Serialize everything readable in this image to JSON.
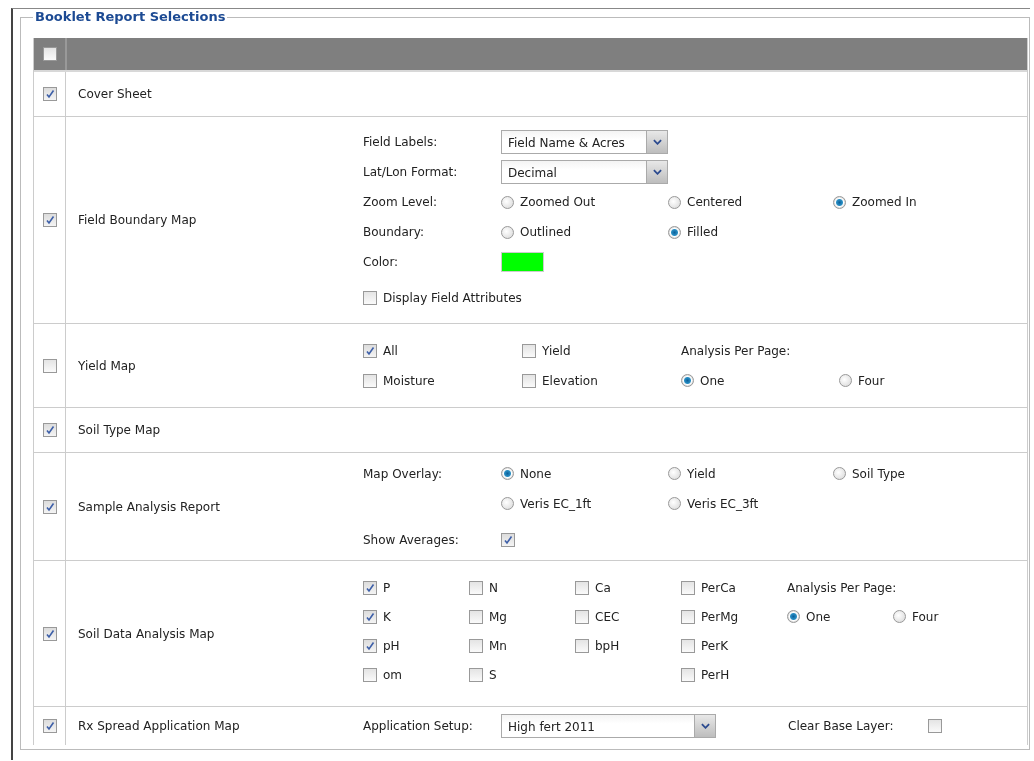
{
  "section": {
    "title": "Booklet Report Selections"
  },
  "select_all": {
    "checked": false
  },
  "reports": [
    {
      "name": "Cover Sheet",
      "checked": true,
      "kind": "plain"
    },
    {
      "name": "Field Boundary Map",
      "checked": true,
      "kind": "field_boundary",
      "lines": [
        [
          {
            "kind": "label",
            "text": "Field Labels:"
          },
          {
            "kind": "select",
            "value": "Field Name & Acres"
          }
        ],
        [
          {
            "kind": "label",
            "text": "Lat/Lon Format:"
          },
          {
            "kind": "select",
            "value": "Decimal"
          }
        ],
        [
          {
            "kind": "label",
            "text": "Zoom Level:"
          },
          {
            "kind": "radio",
            "label": "Zoomed Out",
            "selected": false
          },
          {
            "kind": "radio",
            "label": "Centered",
            "selected": false
          },
          {
            "kind": "radio",
            "label": "Zoomed In",
            "selected": true
          }
        ],
        [
          {
            "kind": "label",
            "text": "Boundary:"
          },
          {
            "kind": "radio",
            "label": "Outlined",
            "selected": false
          },
          {
            "kind": "radio",
            "label": "Filled",
            "selected": true
          }
        ],
        [
          {
            "kind": "label",
            "text": "Color:"
          },
          {
            "kind": "swatch",
            "color": "#00ff00"
          }
        ],
        [
          {
            "kind": "checkbox",
            "label": "Display Field Attributes",
            "checked": false
          }
        ]
      ]
    },
    {
      "name": "Yield Map",
      "checked": false,
      "kind": "yield",
      "lines": [
        [
          {
            "kind": "checkbox",
            "label": "All",
            "checked": true
          },
          {
            "kind": "checkbox",
            "label": "Yield",
            "checked": false
          },
          {
            "kind": "label",
            "text": "Analysis Per Page:"
          }
        ],
        [
          {
            "kind": "checkbox",
            "label": "Moisture",
            "checked": false
          },
          {
            "kind": "checkbox",
            "label": "Elevation",
            "checked": false
          },
          {
            "kind": "radio",
            "label": "One",
            "selected": true
          },
          {
            "kind": "radio",
            "label": "Four",
            "selected": false
          }
        ]
      ]
    },
    {
      "name": "Soil Type Map",
      "checked": true,
      "kind": "plain"
    },
    {
      "name": "Sample Analysis Report",
      "checked": true,
      "kind": "sample",
      "lines": [
        [
          {
            "kind": "label",
            "text": "Map Overlay:"
          },
          {
            "kind": "radio",
            "label": "None",
            "selected": true
          },
          {
            "kind": "radio",
            "label": "Yield",
            "selected": false
          },
          {
            "kind": "radio",
            "label": "Soil Type",
            "selected": false
          }
        ],
        [
          {
            "kind": "radio",
            "label": "Veris EC_1ft",
            "selected": false
          },
          {
            "kind": "radio",
            "label": "Veris EC_3ft",
            "selected": false
          }
        ],
        [
          {
            "kind": "label",
            "text": "Show Averages:"
          },
          {
            "kind": "checkbox",
            "checked": true
          }
        ]
      ]
    },
    {
      "name": "Soil Data Analysis Map",
      "checked": true,
      "kind": "soil_data",
      "columns": [
        [
          {
            "kind": "checkbox",
            "label": "P",
            "checked": true
          },
          {
            "kind": "checkbox",
            "label": "K",
            "checked": true
          },
          {
            "kind": "checkbox",
            "label": "pH",
            "checked": true
          },
          {
            "kind": "checkbox",
            "label": "om",
            "checked": false
          }
        ],
        [
          {
            "kind": "checkbox",
            "label": "N",
            "checked": false
          },
          {
            "kind": "checkbox",
            "label": "Mg",
            "checked": false
          },
          {
            "kind": "checkbox",
            "label": "Mn",
            "checked": false
          },
          {
            "kind": "checkbox",
            "label": "S",
            "checked": false
          }
        ],
        [
          {
            "kind": "checkbox",
            "label": "Ca",
            "checked": false
          },
          {
            "kind": "checkbox",
            "label": "CEC",
            "checked": false
          },
          {
            "kind": "checkbox",
            "label": "bpH",
            "checked": false
          }
        ],
        [
          {
            "kind": "checkbox",
            "label": "PerCa",
            "checked": false
          },
          {
            "kind": "checkbox",
            "label": "PerMg",
            "checked": false
          },
          {
            "kind": "checkbox",
            "label": "PerK",
            "checked": false
          },
          {
            "kind": "checkbox",
            "label": "PerH",
            "checked": false
          }
        ],
        [
          {
            "kind": "label",
            "text": "Analysis Per Page:"
          },
          {
            "kind": "radio",
            "label": "One",
            "selected": true
          },
          {
            "kind": "radio",
            "label": "Four",
            "selected": false
          }
        ]
      ]
    },
    {
      "name": "Rx Spread Application Map",
      "checked": true,
      "kind": "rx",
      "lines": [
        [
          {
            "kind": "label",
            "text": "Application Setup:"
          },
          {
            "kind": "select",
            "value": "High fert 2011"
          },
          {
            "kind": "label",
            "text": "Clear Base Layer:"
          },
          {
            "kind": "checkbox",
            "checked": false
          }
        ]
      ]
    }
  ]
}
